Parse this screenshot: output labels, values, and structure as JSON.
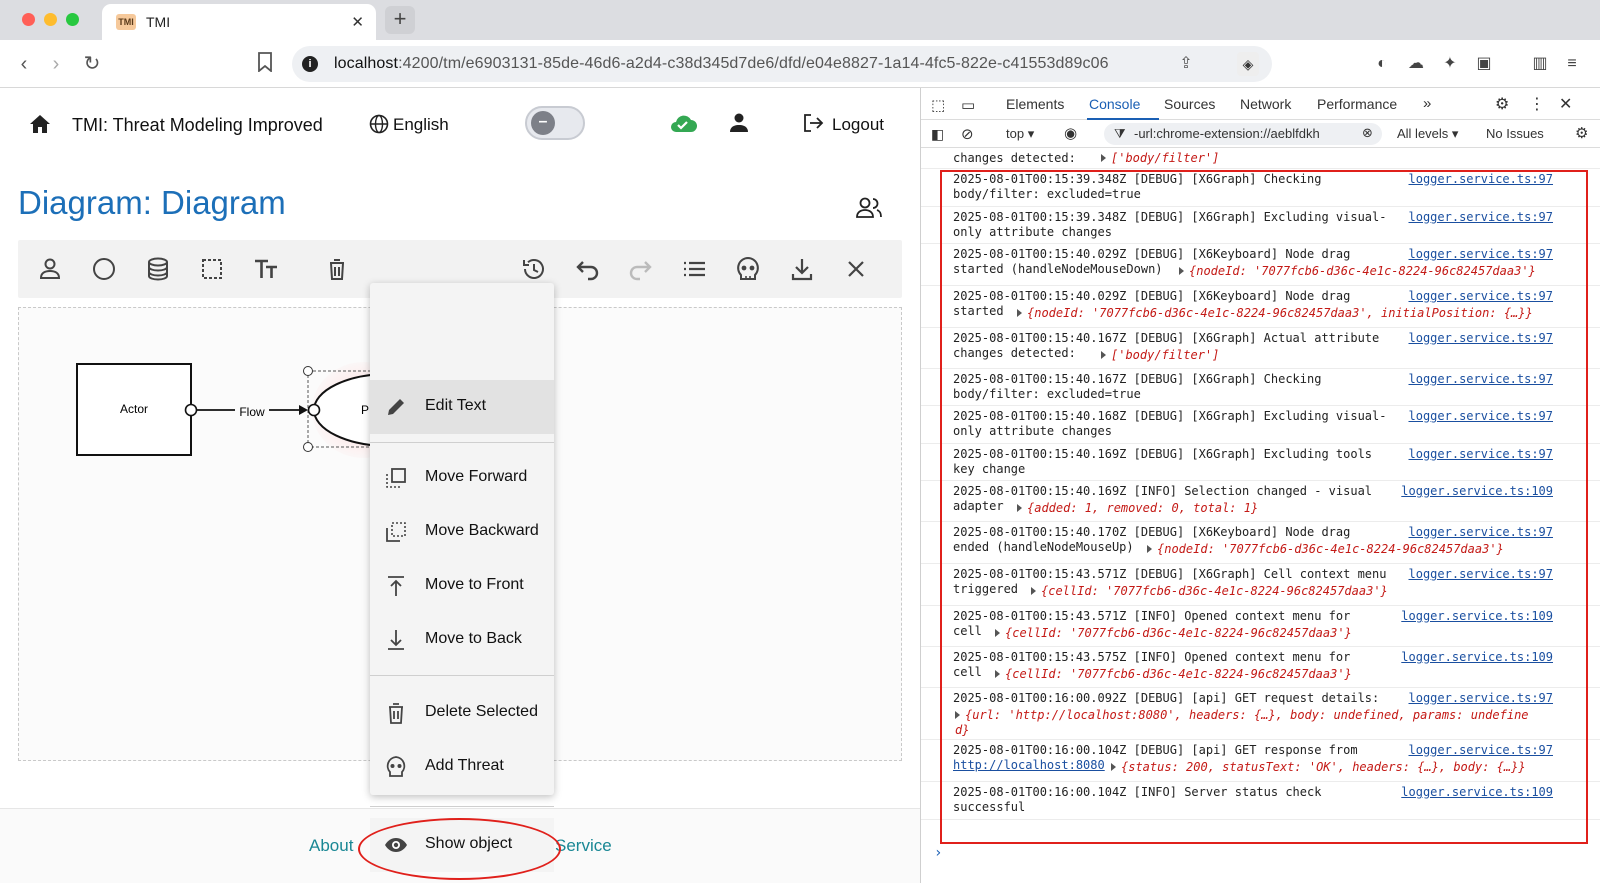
{
  "browser": {
    "tab_title": "TMI",
    "tab_favicon": "TMI",
    "url_host": "localhost",
    "url_rest": ":4200/tm/e6903131-85de-46d6-a2d4-c38d345d7de6/dfd/e04e8827-1a14-4fc5-822e-c41553d89c06"
  },
  "app": {
    "title": "TMI: Threat Modeling Improved",
    "language": "English",
    "logout": "Logout",
    "diagram_title": "Diagram: Diagram"
  },
  "diagram": {
    "actor_label": "Actor",
    "flow_label": "Flow",
    "process_label": "P"
  },
  "context_menu": {
    "items": [
      "Edit Text",
      "Move Forward",
      "Move Backward",
      "Move to Front",
      "Move to Back",
      "Delete Selected",
      "Add Threat",
      "Show object"
    ]
  },
  "footer": {
    "about": "About",
    "service": "Service"
  },
  "devtools": {
    "tabs": [
      "Elements",
      "Console",
      "Sources",
      "Network",
      "Performance"
    ],
    "context": "top",
    "filter": "-url:chrome-extension://aeblfdkh",
    "levels": "All levels",
    "issues": "No Issues",
    "logs": [
      {
        "msg": "changes detected:",
        "src": "",
        "obj": "['body/filter']"
      },
      {
        "msg": "2025-08-01T00:15:39.348Z [DEBUG] [X6Graph] Checking\nbody/filter: excluded=true",
        "src": "logger.service.ts:97",
        "obj": ""
      },
      {
        "msg": "2025-08-01T00:15:39.348Z [DEBUG] [X6Graph] Excluding visual-\nonly attribute changes",
        "src": "logger.service.ts:97",
        "obj": ""
      },
      {
        "msg": "2025-08-01T00:15:40.029Z [DEBUG] [X6Keyboard] Node drag\nstarted (handleNodeMouseDown)",
        "src": "logger.service.ts:97",
        "obj": "{nodeId: '7077fcb6-d36c-4e1c-8224-96c82457daa3'}"
      },
      {
        "msg": "2025-08-01T00:15:40.029Z [DEBUG] [X6Keyboard] Node drag\nstarted",
        "src": "logger.service.ts:97",
        "obj": "{nodeId: '7077fcb6-d36c-4e1c-8224-96c82457daa3', initialPosition: {…}}"
      },
      {
        "msg": "2025-08-01T00:15:40.167Z [DEBUG] [X6Graph] Actual attribute\nchanges detected:",
        "src": "logger.service.ts:97",
        "obj": "['body/filter']"
      },
      {
        "msg": "2025-08-01T00:15:40.167Z [DEBUG] [X6Graph] Checking\nbody/filter: excluded=true",
        "src": "logger.service.ts:97",
        "obj": ""
      },
      {
        "msg": "2025-08-01T00:15:40.168Z [DEBUG] [X6Graph] Excluding visual-\nonly attribute changes",
        "src": "logger.service.ts:97",
        "obj": ""
      },
      {
        "msg": "2025-08-01T00:15:40.169Z [DEBUG] [X6Graph] Excluding tools\nkey change",
        "src": "logger.service.ts:97",
        "obj": ""
      },
      {
        "msg": "2025-08-01T00:15:40.169Z [INFO] Selection changed - visual\nadapter",
        "src": "logger.service.ts:109",
        "obj": "{added: 1, removed: 0, total: 1}"
      },
      {
        "msg": "2025-08-01T00:15:40.170Z [DEBUG] [X6Keyboard] Node drag\nended (handleNodeMouseUp)",
        "src": "logger.service.ts:97",
        "obj": "{nodeId: '7077fcb6-d36c-4e1c-8224-96c82457daa3'}"
      },
      {
        "msg": "2025-08-01T00:15:43.571Z [DEBUG] [X6Graph] Cell context menu\ntriggered",
        "src": "logger.service.ts:97",
        "obj": "{cellId: '7077fcb6-d36c-4e1c-8224-96c82457daa3'}"
      },
      {
        "msg": "2025-08-01T00:15:43.571Z [INFO] Opened context menu for\ncell",
        "src": "logger.service.ts:109",
        "obj": "{cellId: '7077fcb6-d36c-4e1c-8224-96c82457daa3'}"
      },
      {
        "msg": "2025-08-01T00:15:43.575Z [INFO] Opened context menu for\ncell",
        "src": "logger.service.ts:109",
        "obj": "{cellId: '7077fcb6-d36c-4e1c-8224-96c82457daa3'}"
      },
      {
        "msg": "2025-08-01T00:16:00.092Z [DEBUG] [api] GET request details:",
        "src": "logger.service.ts:97",
        "obj": "{url: 'http://localhost:8080', headers: {…}, body: undefined, params: undefine\nd}"
      },
      {
        "msg": "2025-08-01T00:16:00.104Z [DEBUG] [api] GET response from",
        "src": "logger.service.ts:97",
        "obj": "{status: 200, statusText: 'OK', headers: {…}, body: {…}}",
        "link": "http://localhost:8080"
      },
      {
        "msg": "2025-08-01T00:16:00.104Z [INFO] Server status check\nsuccessful",
        "src": "logger.service.ts:109",
        "obj": ""
      }
    ]
  },
  "colors": {
    "accent": "#1c6fb8",
    "footer_link": "#198794",
    "annotation_red": "#e0201b",
    "cloud_ok": "#34a853"
  }
}
